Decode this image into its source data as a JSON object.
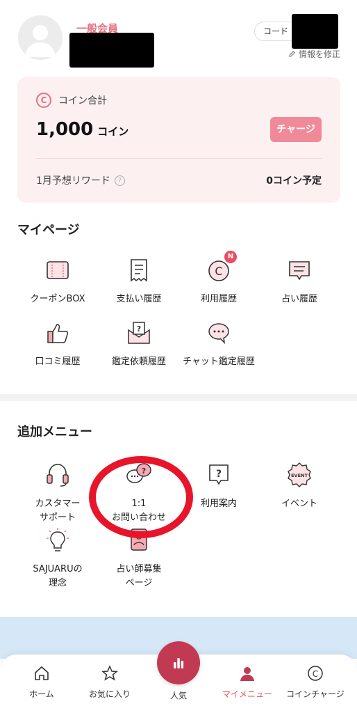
{
  "profile": {
    "member_grade": "一般会員",
    "code_button": "コード",
    "edit_link": "情報を修正"
  },
  "coins": {
    "title": "コイン合計",
    "icon_letter": "C",
    "amount": "1,000",
    "unit": "コイン",
    "charge_button": "チャージ",
    "reward_label": "1月予想リワード",
    "reward_value": "0コイン予定"
  },
  "mypage": {
    "title": "マイページ",
    "items": [
      {
        "label": "クーポンBOX",
        "icon": "ticket-icon"
      },
      {
        "label": "支払い履歴",
        "icon": "receipt-icon"
      },
      {
        "label": "利用履歴",
        "icon": "coin-history-icon",
        "badge": "N"
      },
      {
        "label": "占い履歴",
        "icon": "chat-list-icon"
      },
      {
        "label": "口コミ履歴",
        "icon": "thumbs-up-icon"
      },
      {
        "label": "鑑定依頼履歴",
        "icon": "question-envelope-icon"
      },
      {
        "label": "チャット鑑定履歴",
        "icon": "chat-bubbles-icon"
      }
    ]
  },
  "extra_menu": {
    "title": "追加メニュー",
    "items": [
      {
        "label_line1": "カスタマー",
        "label_line2": "サポート",
        "icon": "headset-icon"
      },
      {
        "label_line1": "1:1",
        "label_line2": "お問い合わせ",
        "icon": "inquiry-bubbles-icon"
      },
      {
        "label_line1": "利用案内",
        "label_line2": "",
        "icon": "question-bubble-icon"
      },
      {
        "label_line1": "イベント",
        "label_line2": "",
        "icon": "event-badge-icon"
      },
      {
        "label_line1": "SAJUARUの",
        "label_line2": "理念",
        "icon": "lightbulb-icon"
      },
      {
        "label_line1": "占い師募集",
        "label_line2": "ページ",
        "icon": "recruit-icon"
      }
    ],
    "event_badge_text": "EVENT"
  },
  "tabbar": {
    "home": "ホーム",
    "favorites": "お気に入り",
    "popular": "人気",
    "my_menu": "マイメニュー",
    "coin_charge": "コインチャージ",
    "coin_icon_letter": "C"
  },
  "colors": {
    "accent": "#e8707e",
    "card_bg": "#fdf0f1",
    "badge": "#e84e5f",
    "center_tab": "#c13a52",
    "annotation": "#e8142a"
  }
}
